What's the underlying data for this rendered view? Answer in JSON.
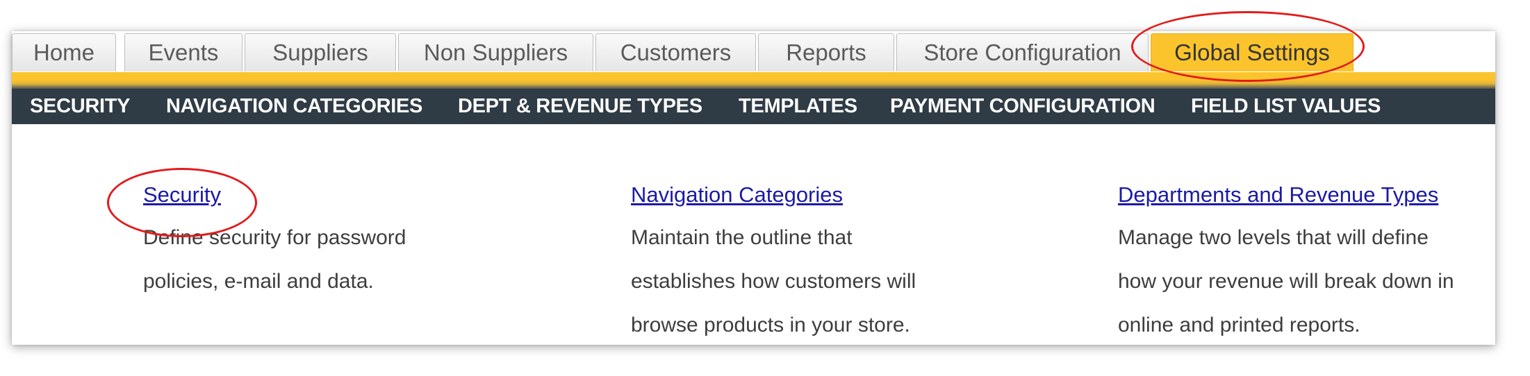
{
  "tabs": [
    {
      "label": "Home",
      "active": false
    },
    {
      "label": "Events",
      "active": false
    },
    {
      "label": "Suppliers",
      "active": false
    },
    {
      "label": "Non Suppliers",
      "active": false
    },
    {
      "label": "Customers",
      "active": false
    },
    {
      "label": "Reports",
      "active": false
    },
    {
      "label": "Store Configuration",
      "active": false
    },
    {
      "label": "Global Settings",
      "active": true
    }
  ],
  "subnav": [
    {
      "label": "SECURITY"
    },
    {
      "label": "NAVIGATION CATEGORIES"
    },
    {
      "label": "DEPT & REVENUE TYPES"
    },
    {
      "label": "TEMPLATES"
    },
    {
      "label": "PAYMENT CONFIGURATION"
    },
    {
      "label": "FIELD LIST VALUES"
    }
  ],
  "sections": [
    {
      "link": "Security",
      "description": "Define security for password policies, e-mail and data."
    },
    {
      "link": "Navigation Categories",
      "description": "Maintain the outline that establishes how customers will browse products in your store."
    },
    {
      "link": "Departments and Revenue Types",
      "description": "Manage two levels that will define how your revenue will break down in online and printed reports."
    }
  ],
  "colors": {
    "active_tab": "#fcc42c",
    "nav_background": "#2f3b45",
    "link": "#1a1aa6",
    "annotation": "#e21b1b"
  }
}
